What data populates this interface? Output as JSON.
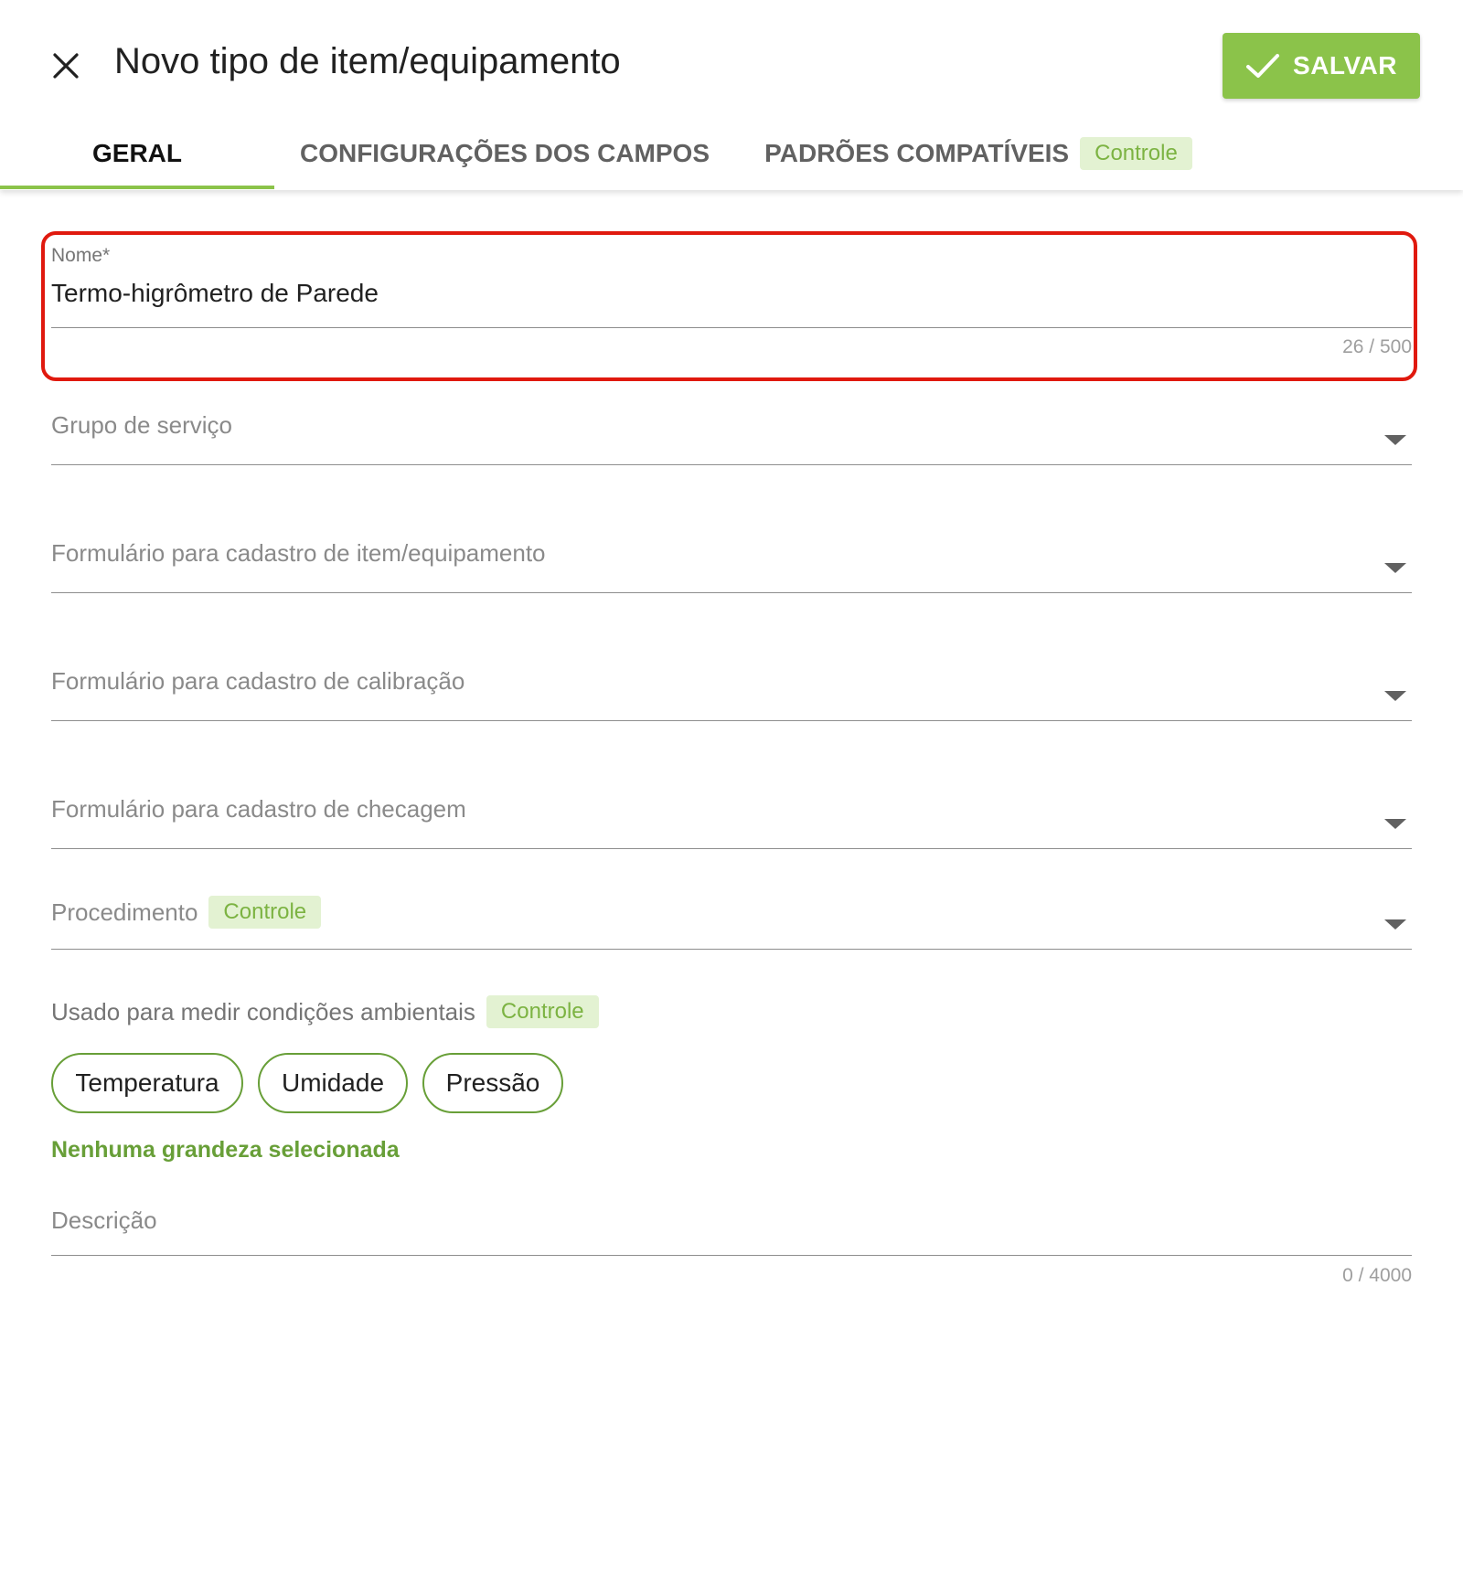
{
  "header": {
    "title": "Novo tipo de item/equipamento",
    "close_icon": "close-icon",
    "save_label": "SALVAR",
    "save_icon": "check-icon",
    "save_color": "#8bc34a"
  },
  "tabs": [
    {
      "label": "GERAL",
      "active": true
    },
    {
      "label": "CONFIGURAÇÕES DOS CAMPOS",
      "active": false
    },
    {
      "label": "PADRÕES COMPATÍVEIS",
      "active": false,
      "badge": "Controle"
    }
  ],
  "form": {
    "nome": {
      "label": "Nome*",
      "value": "Termo-higrômetro de Parede",
      "counter": "26 / 500",
      "highlight_color": "#e0190e"
    },
    "grupo_servico": {
      "placeholder": "Grupo de serviço"
    },
    "form_item": {
      "placeholder": "Formulário para cadastro de item/equipamento"
    },
    "form_calibracao": {
      "placeholder": "Formulário para cadastro de calibração"
    },
    "form_checagem": {
      "placeholder": "Formulário para cadastro de checagem"
    },
    "procedimento": {
      "placeholder": "Procedimento",
      "badge": "Controle"
    },
    "condicoes": {
      "label": "Usado para medir condições ambientais",
      "badge": "Controle",
      "chips": [
        "Temperatura",
        "Umidade",
        "Pressão"
      ],
      "hint": "Nenhuma grandeza selecionada"
    },
    "descricao": {
      "placeholder": "Descrição",
      "counter": "0 / 4000"
    }
  },
  "colors": {
    "accent": "#8bc34a",
    "accent_dark": "#689f38",
    "badge_bg": "#e3f2d2"
  }
}
